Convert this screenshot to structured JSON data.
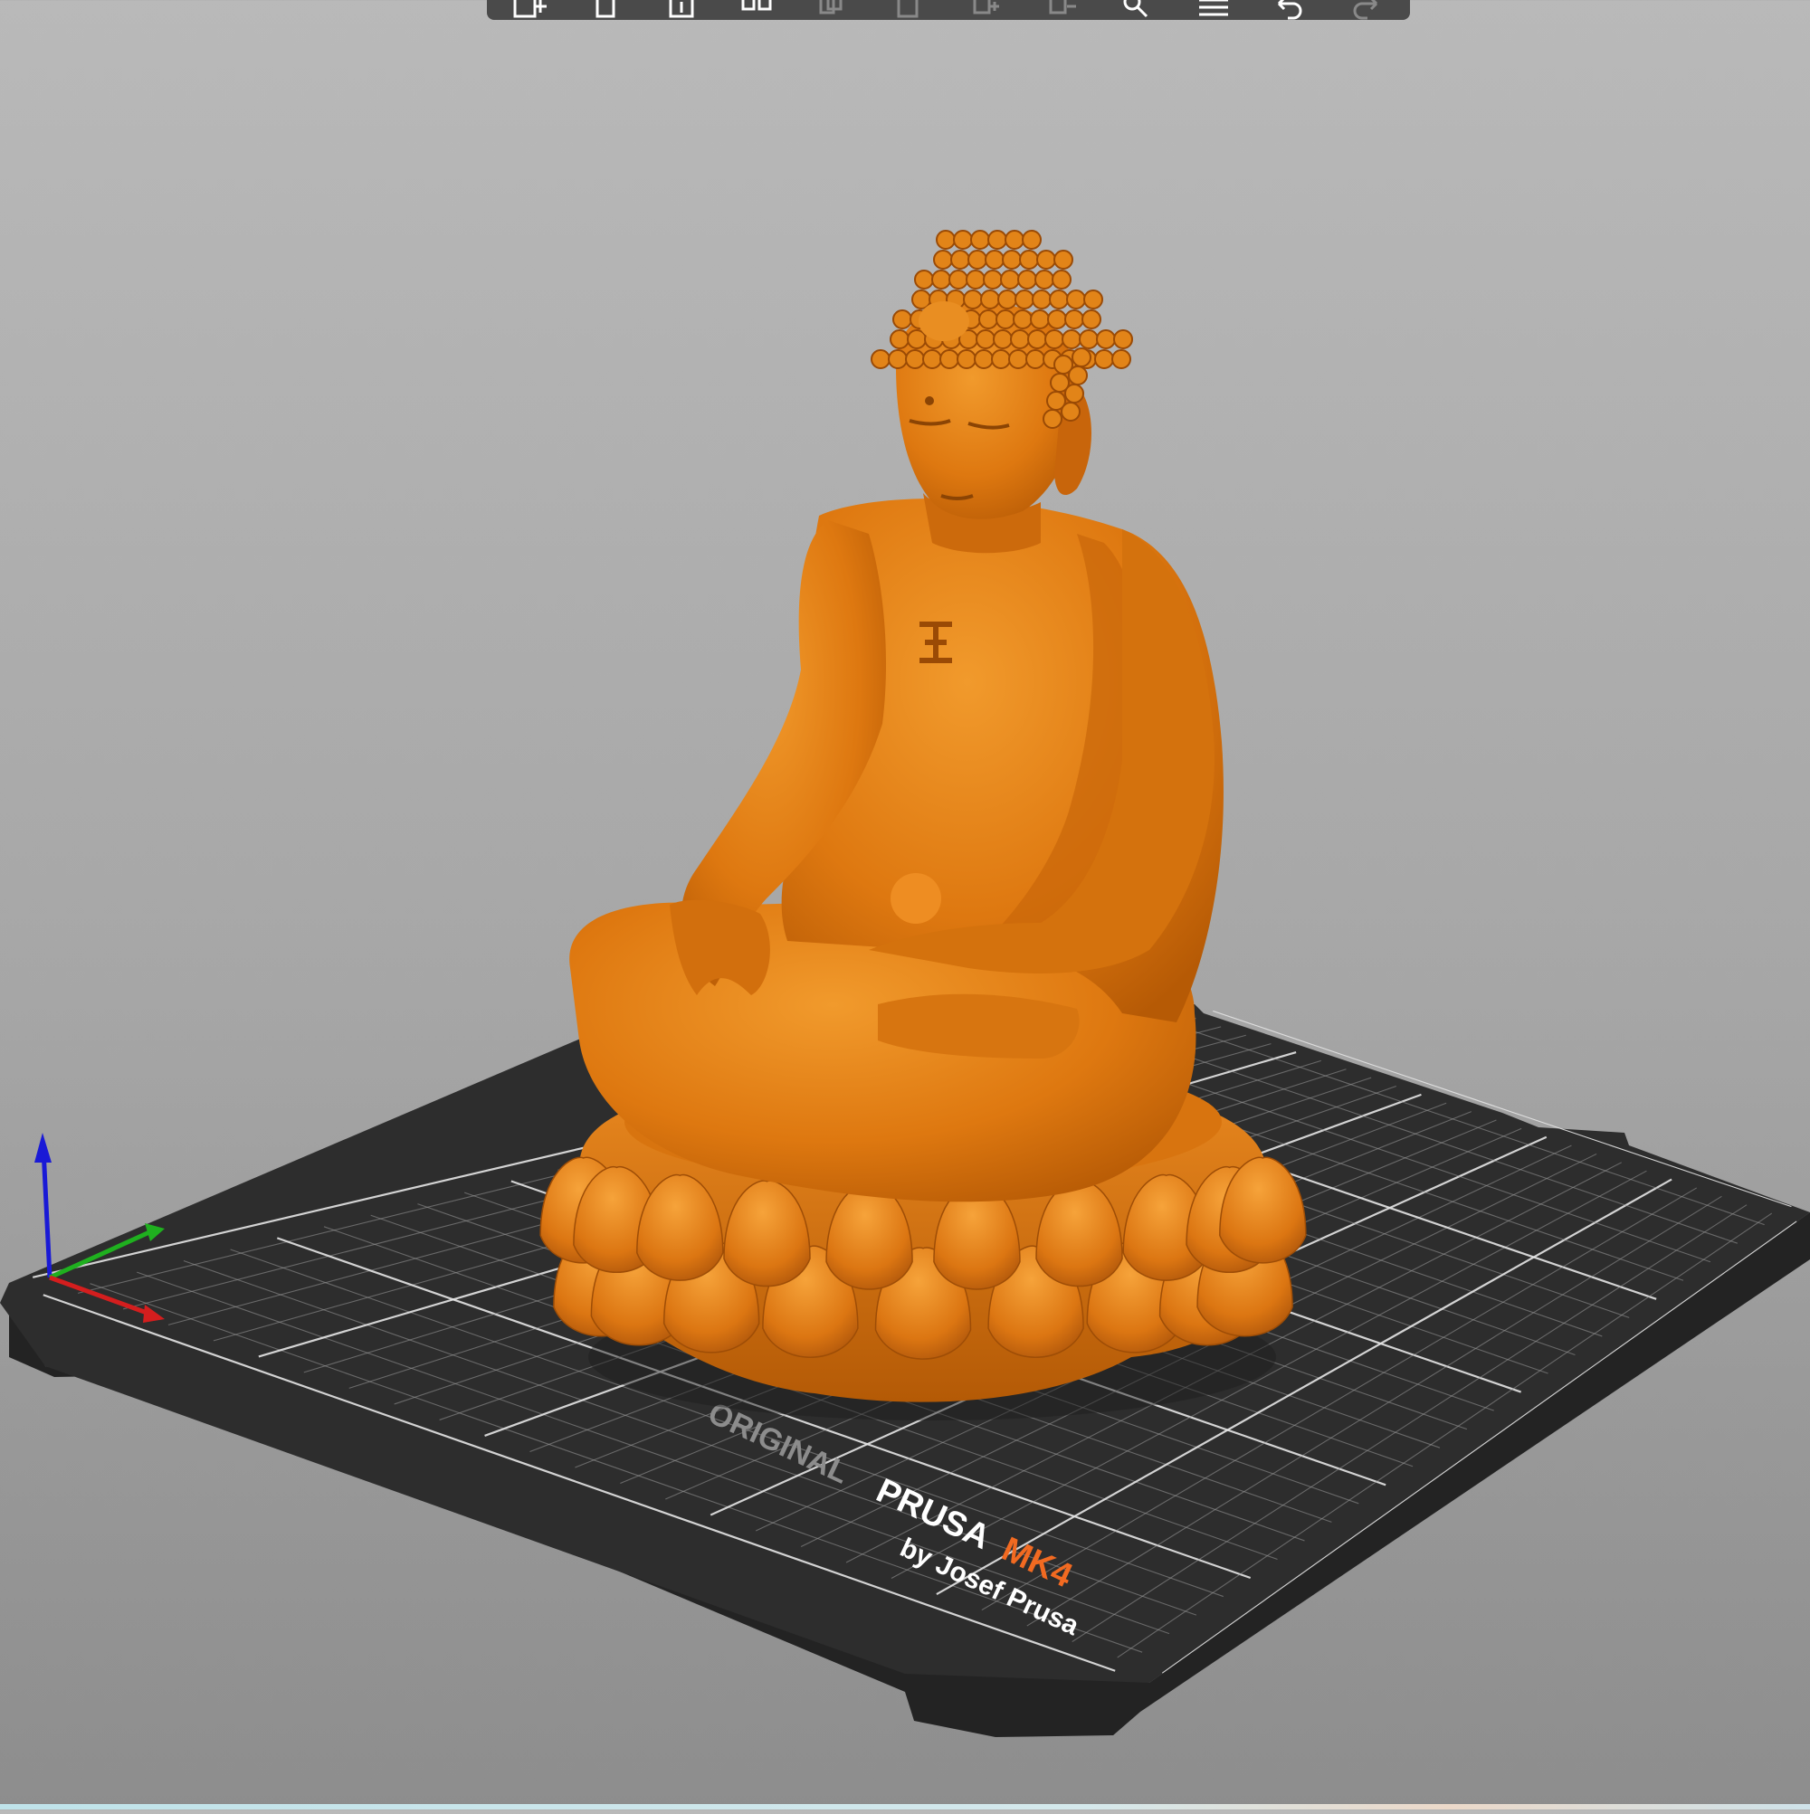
{
  "viewport": {
    "background_top": "#b9b9b9",
    "background_bottom": "#8d8d8d"
  },
  "toolbar": {
    "buttons": [
      {
        "name": "add-object",
        "icon": "cube-plus-icon",
        "enabled": true
      },
      {
        "name": "delete",
        "icon": "trash-icon",
        "enabled": true
      },
      {
        "name": "delete-all",
        "icon": "trash-all-icon",
        "enabled": true
      },
      {
        "name": "arrange",
        "icon": "arrange-icon",
        "enabled": true
      },
      {
        "name": "copy",
        "icon": "copy-icon",
        "enabled": false
      },
      {
        "name": "paste",
        "icon": "paste-icon",
        "enabled": false
      },
      {
        "name": "add-instance",
        "icon": "instance-plus-icon",
        "enabled": false
      },
      {
        "name": "remove-instance",
        "icon": "instance-minus-icon",
        "enabled": false
      },
      {
        "name": "search",
        "icon": "search-icon",
        "enabled": true
      },
      {
        "name": "layers-editing",
        "icon": "layers-icon",
        "enabled": true
      },
      {
        "name": "undo",
        "icon": "undo-icon",
        "enabled": true
      },
      {
        "name": "redo",
        "icon": "redo-icon",
        "enabled": false
      }
    ]
  },
  "bed": {
    "brand_line1": "ORIGINAL",
    "brand_word": "PRUSA",
    "brand_model": "MK4",
    "brand_line2": "by Josef Prusa",
    "plate_color": "#2d2d2d",
    "grid_color": "#9a9a9a",
    "accent_color": "#f26a21"
  },
  "model": {
    "name": "buddha statue",
    "color": "#e07a10"
  },
  "axes": {
    "x_color": "#d41e1e",
    "y_color": "#1fb01f",
    "z_color": "#1a1ad6"
  }
}
